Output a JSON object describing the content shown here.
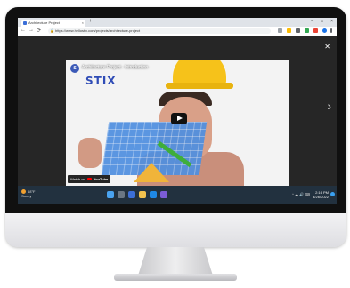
{
  "browser": {
    "tab_title": "Architecture Project",
    "url": "https://www.hellostix.com/projects/architecture-project",
    "tab_close": "×",
    "new_tab": "+",
    "window_controls": [
      "–",
      "□",
      "×"
    ],
    "nav": {
      "back": "←",
      "forward": "→",
      "reload": "⟳"
    }
  },
  "viewer": {
    "close": "✕",
    "next": "›"
  },
  "video": {
    "channel_initial": "S",
    "title": "Architecture Project - Introduction",
    "logo_text": "STIX",
    "watch_on": "Watch on",
    "youtube": "YouTube"
  },
  "taskbar": {
    "weather_temp": "68°F",
    "weather_desc": "Sunny",
    "time": "2:16 PM",
    "date": "4/26/2022",
    "tray": "^  ☁  🔊  ⌨"
  },
  "colors": {
    "accent": "#3b59b7",
    "helmet": "#f6c21a",
    "blueprint": "#4f8fe0",
    "taskbar": "#22313f"
  }
}
